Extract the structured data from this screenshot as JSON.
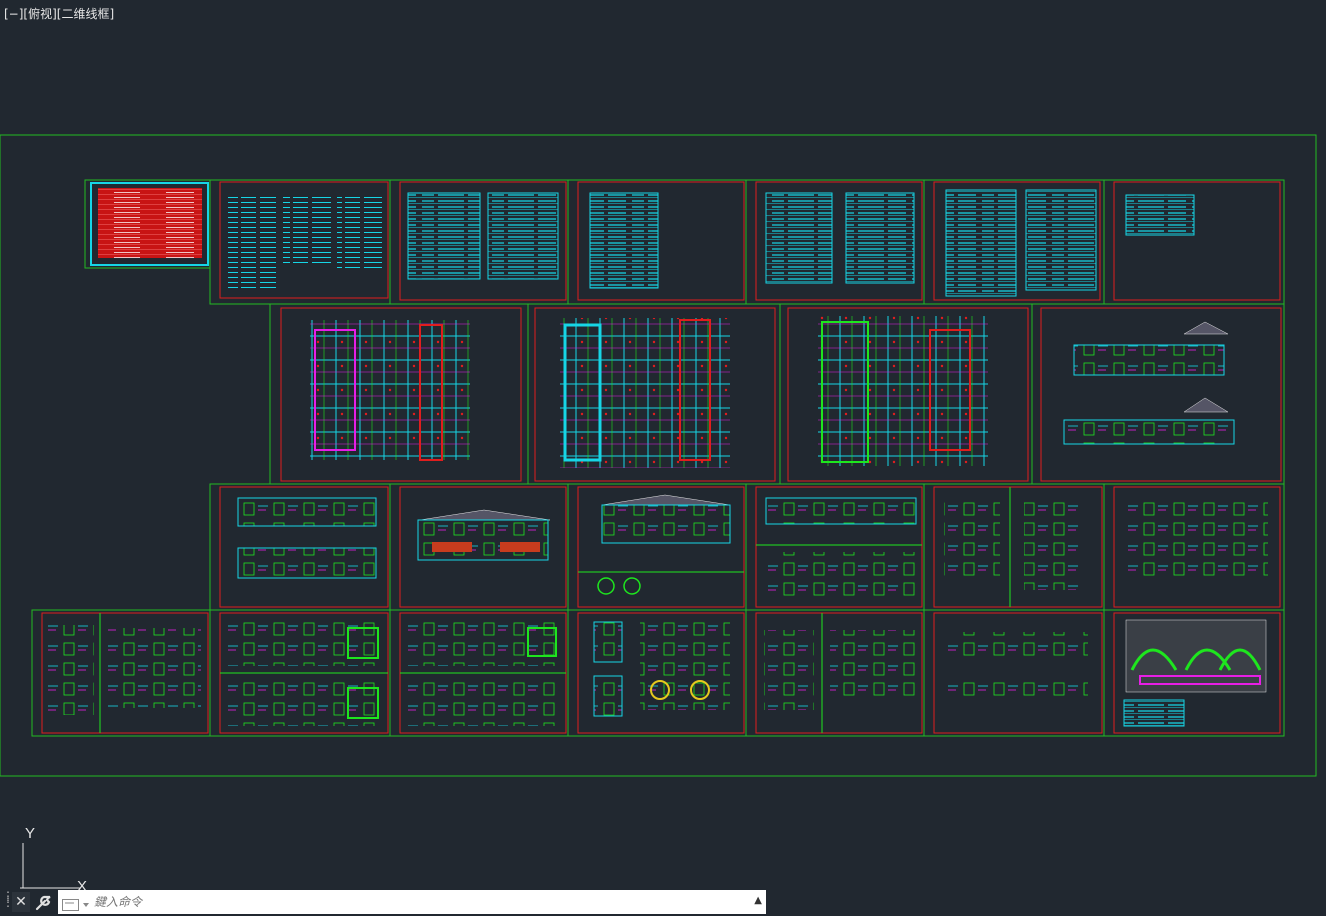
{
  "viewport": {
    "bracket_minus": "[−]",
    "view": "[俯视]",
    "style": "[二维线框]"
  },
  "ucs": {
    "y_label": "Y",
    "x_label": "X"
  },
  "command_line": {
    "placeholder": "鍵入命令",
    "close_glyph": "✕",
    "history_glyph": "▲"
  },
  "colors": {
    "background": "#212830",
    "frame_outer": "#22bb22",
    "sheet_border": "#e01e1e",
    "cyan_content": "#16d6e6",
    "green_content": "#1ee61e",
    "magenta_content": "#e61ee6",
    "red_table": "#e01e1e"
  },
  "icons": {
    "close": "close-icon",
    "settings": "wrench-icon",
    "prompt": "command-prompt-icon",
    "history": "chevron-up-icon"
  }
}
